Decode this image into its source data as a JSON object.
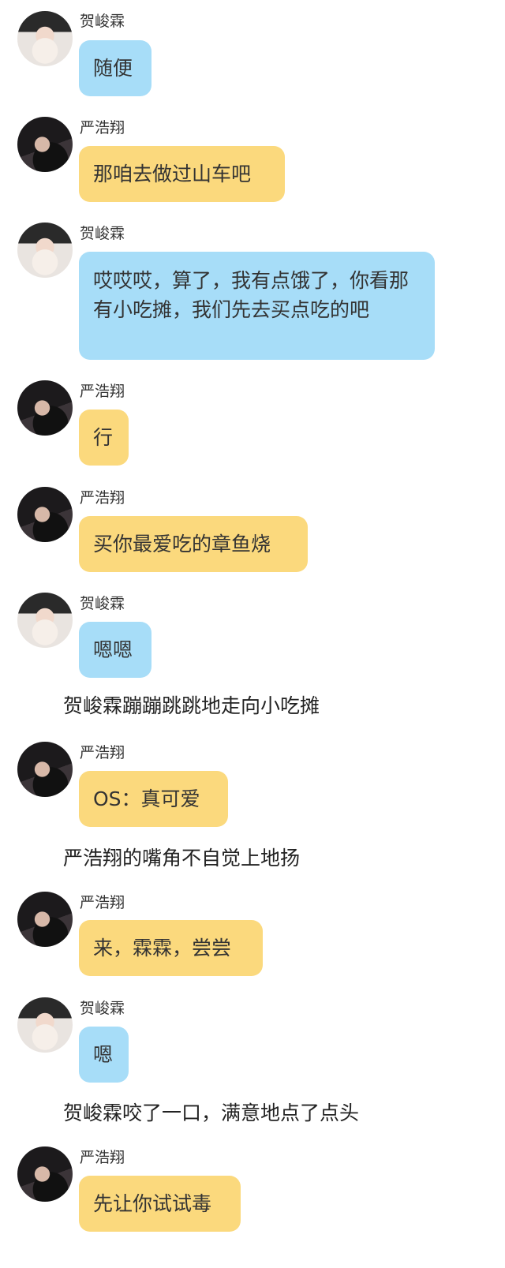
{
  "messages": [
    {
      "speaker": "贺峻霖",
      "text": "随便"
    },
    {
      "speaker": "严浩翔",
      "text": "那咱去做过山车吧"
    },
    {
      "speaker": "贺峻霖",
      "text": "哎哎哎，算了，我有点饿了，你看那有小吃摊，我们先去买点吃的吧"
    },
    {
      "speaker": "严浩翔",
      "text": "行"
    },
    {
      "speaker": "严浩翔",
      "text": "买你最爱吃的章鱼烧"
    },
    {
      "speaker": "贺峻霖",
      "text": "嗯嗯"
    },
    {
      "narration": "贺峻霖蹦蹦跳跳地走向小吃摊"
    },
    {
      "speaker": "严浩翔",
      "text": "OS：真可爱"
    },
    {
      "narration": "严浩翔的嘴角不自觉上地扬"
    },
    {
      "speaker": "严浩翔",
      "text": "来，霖霖，尝尝"
    },
    {
      "speaker": "贺峻霖",
      "text": "嗯"
    },
    {
      "narration": "贺峻霖咬了一口，满意地点了点头"
    },
    {
      "speaker": "严浩翔",
      "text": "先让你试试毒"
    }
  ]
}
